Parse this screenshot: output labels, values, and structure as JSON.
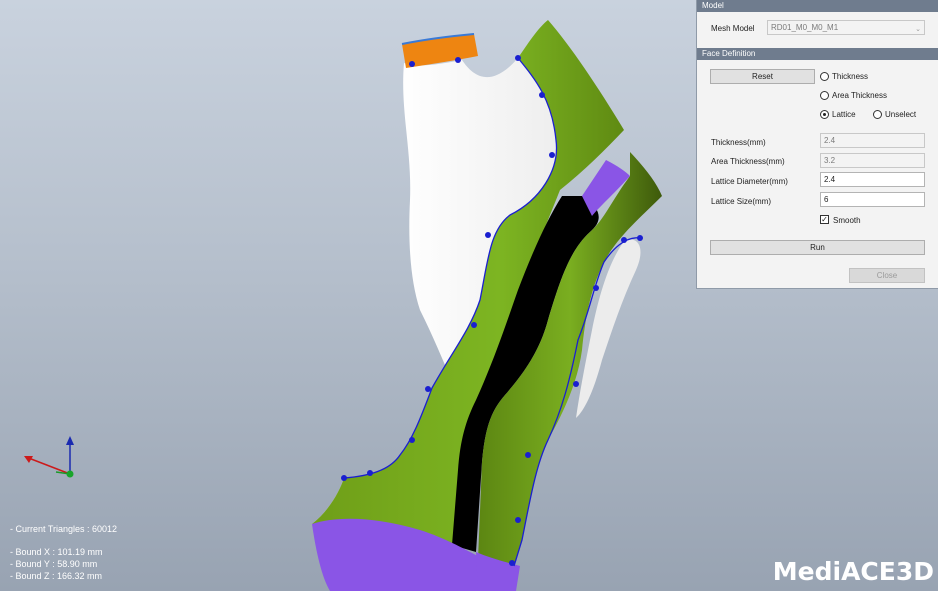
{
  "viewport": {
    "stats": {
      "triangles": "- Current Triangles : 60012",
      "bound_x": "- Bound X : 101.19 mm",
      "bound_y": "- Bound Y : 58.90 mm",
      "bound_z": "- Bound Z : 166.32 mm"
    },
    "logo_text": "MediACE3D",
    "colors": {
      "shell": "#ffffff",
      "green": "#79ad1e",
      "purple": "#8a55e6",
      "orange": "#ee8511",
      "black": "#000000",
      "control_point": "#1a1fd0"
    }
  },
  "panel": {
    "model_header": "Model",
    "mesh_model_label": "Mesh Model",
    "mesh_model_value": "RD01_M0_M0_M1",
    "face_header": "Face Definition",
    "reset_label": "Reset",
    "radio_thickness": "Thickness",
    "radio_area_thickness": "Area Thickness",
    "radio_lattice": "Lattice",
    "radio_unselect": "Unselect",
    "selected_mode": "Lattice",
    "thickness_label": "Thickness(mm)",
    "thickness_value": "2.4",
    "area_thickness_label": "Area Thickness(mm)",
    "area_thickness_value": "3.2",
    "lattice_diameter_label": "Lattice Diameter(mm)",
    "lattice_diameter_value": "2.4",
    "lattice_size_label": "Lattice Size(mm)",
    "lattice_size_value": "6",
    "smooth_label": "Smooth",
    "smooth_checked": true,
    "run_label": "Run",
    "close_label": "Close"
  }
}
